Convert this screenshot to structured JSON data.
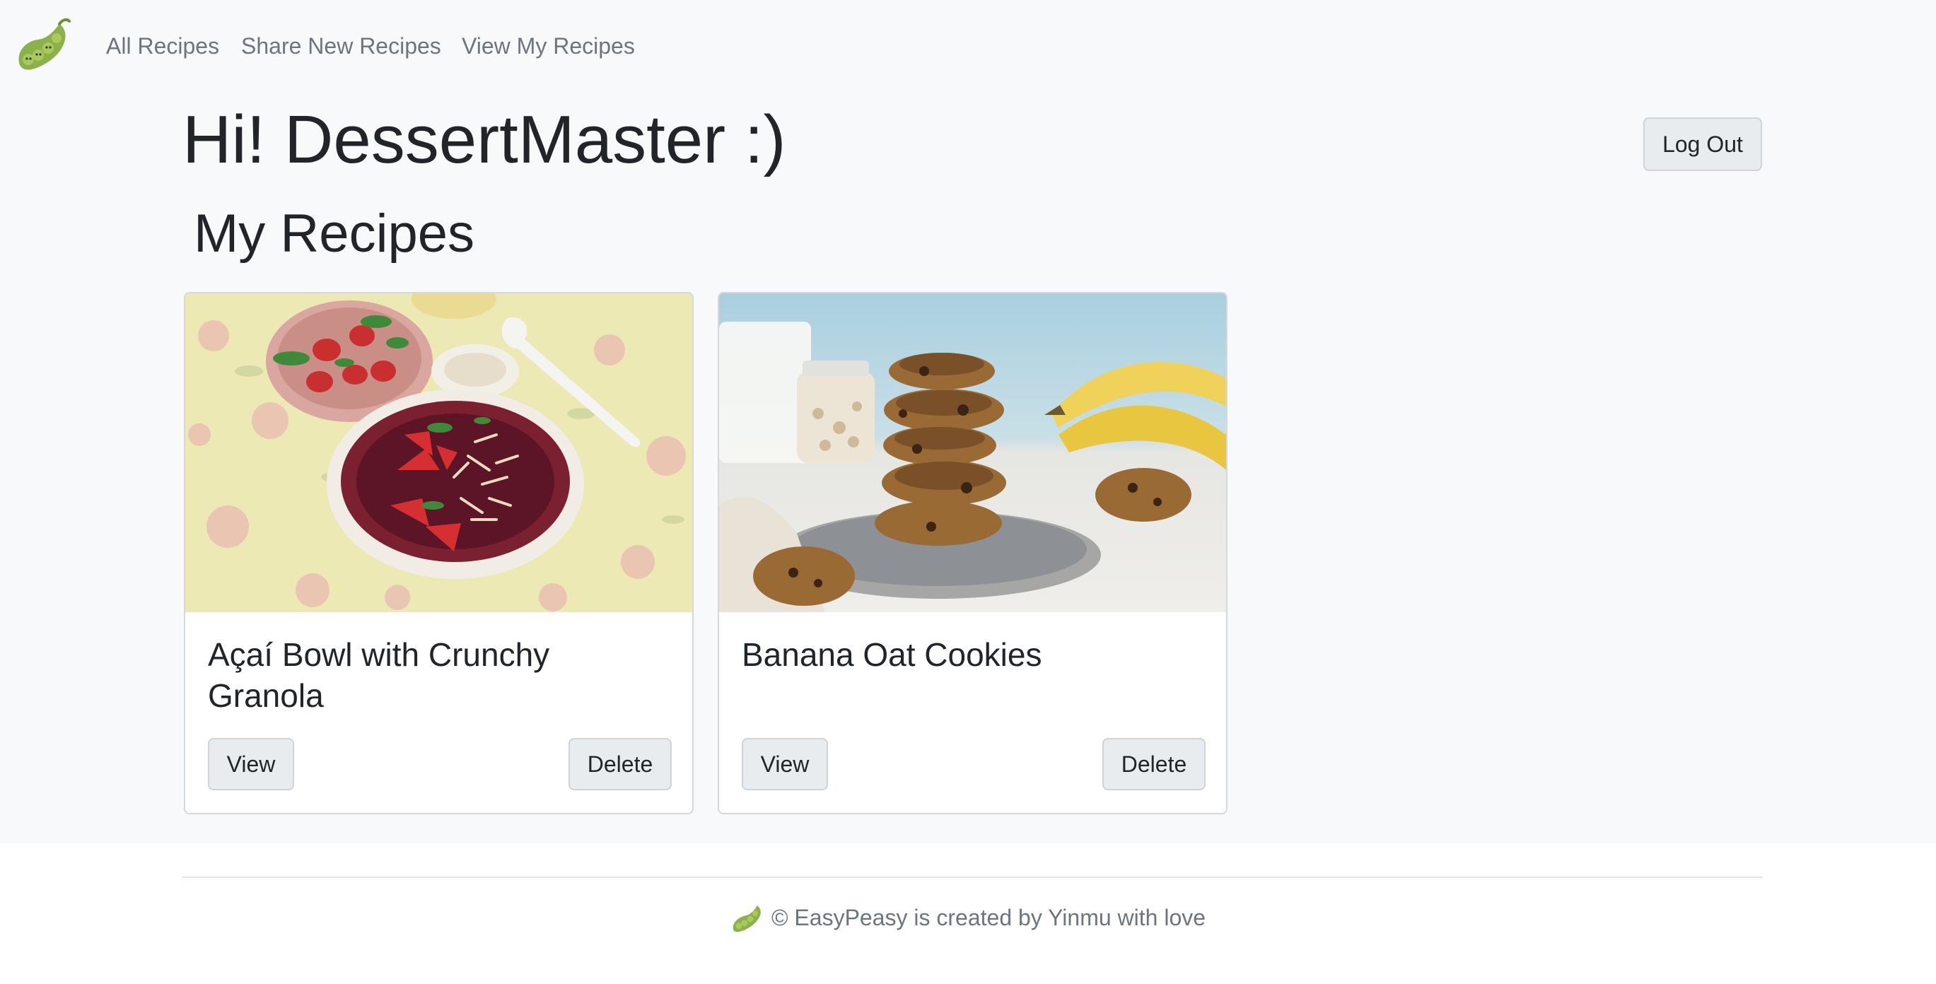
{
  "nav": {
    "logo_icon": "pea-pod-logo-icon",
    "links": [
      {
        "label": "All Recipes"
      },
      {
        "label": "Share New Recipes"
      },
      {
        "label": "View My Recipes"
      }
    ]
  },
  "header": {
    "greeting": "Hi! DessertMaster :)",
    "logout_label": "Log Out"
  },
  "main": {
    "section_title": "My Recipes",
    "recipes": [
      {
        "title": "Açaí Bowl with Crunchy Granola",
        "image": "acai-bowl-photo",
        "view_label": "View",
        "delete_label": "Delete"
      },
      {
        "title": "Banana Oat Cookies",
        "image": "banana-oat-cookies-photo",
        "view_label": "View",
        "delete_label": "Delete"
      }
    ]
  },
  "footer": {
    "icon": "pea-pod-icon",
    "text": "© EasyPeasy is created by Yinmu with love"
  },
  "colors": {
    "page_background": "#f8f9fa",
    "button_background": "#e9ecef",
    "nav_link": "#6c757d",
    "text": "#212529"
  }
}
